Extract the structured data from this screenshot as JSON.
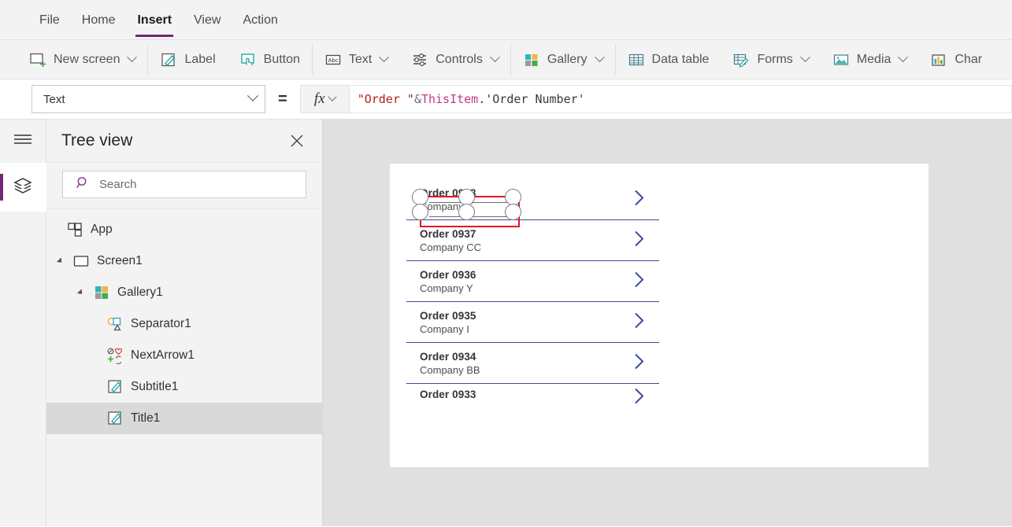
{
  "theme": {
    "accent": "#742774",
    "selection_red": "#e81123",
    "chevron_blue": "#3c4a9e"
  },
  "menubar": {
    "tabs": [
      {
        "label": "File",
        "active": false
      },
      {
        "label": "Home",
        "active": false
      },
      {
        "label": "Insert",
        "active": true
      },
      {
        "label": "View",
        "active": false
      },
      {
        "label": "Action",
        "active": false
      }
    ]
  },
  "ribbon": {
    "items": [
      {
        "label": "New screen",
        "icon": "new-screen-icon",
        "caret": true
      },
      {
        "label": "Label",
        "icon": "label-icon",
        "caret": false
      },
      {
        "label": "Button",
        "icon": "button-icon",
        "caret": false
      },
      {
        "label": "Text",
        "icon": "text-abc-icon",
        "caret": true
      },
      {
        "label": "Controls",
        "icon": "controls-icon",
        "caret": true
      },
      {
        "label": "Gallery",
        "icon": "gallery-icon",
        "caret": true
      },
      {
        "label": "Data table",
        "icon": "data-table-icon",
        "caret": false
      },
      {
        "label": "Forms",
        "icon": "forms-icon",
        "caret": true
      },
      {
        "label": "Media",
        "icon": "media-icon",
        "caret": true
      },
      {
        "label": "Char",
        "icon": "charts-icon",
        "caret": false
      }
    ]
  },
  "formulabar": {
    "property": "Text",
    "equals": "=",
    "fx_label": "fx",
    "formula_tokens": [
      {
        "text": "\"Order \"",
        "type": "string"
      },
      {
        "text": " & ",
        "type": "operator"
      },
      {
        "text": "ThisItem",
        "type": "identifier"
      },
      {
        "text": ".'Order Number'",
        "type": "plain"
      }
    ]
  },
  "treeview": {
    "title": "Tree view",
    "close_label": "✕",
    "search": {
      "placeholder": "Search",
      "value": ""
    },
    "nodes": [
      {
        "label": "App",
        "icon": "app-icon",
        "indent": 0,
        "twisty": "none",
        "selected": false
      },
      {
        "label": "Screen1",
        "icon": "screen-icon",
        "indent": 1,
        "twisty": "expanded",
        "selected": false
      },
      {
        "label": "Gallery1",
        "icon": "gallery-icon",
        "indent": 2,
        "twisty": "expanded",
        "selected": false
      },
      {
        "label": "Separator1",
        "icon": "shapes-icon",
        "indent": 3,
        "twisty": "none",
        "selected": false
      },
      {
        "label": "NextArrow1",
        "icon": "icons-icon",
        "indent": 3,
        "twisty": "none",
        "selected": false
      },
      {
        "label": "Subtitle1",
        "icon": "label-icon",
        "indent": 3,
        "twisty": "none",
        "selected": false
      },
      {
        "label": "Title1",
        "icon": "label-icon",
        "indent": 3,
        "twisty": "none",
        "selected": true
      }
    ]
  },
  "canvas": {
    "gallery": {
      "items": [
        {
          "title": "Order 0938",
          "subtitle": "Company F",
          "selected": true,
          "clipped": false
        },
        {
          "title": "Order 0937",
          "subtitle": "Company CC",
          "selected": false,
          "clipped": false
        },
        {
          "title": "Order 0936",
          "subtitle": "Company Y",
          "selected": false,
          "clipped": false
        },
        {
          "title": "Order 0935",
          "subtitle": "Company I",
          "selected": false,
          "clipped": false
        },
        {
          "title": "Order 0934",
          "subtitle": "Company BB",
          "selected": false,
          "clipped": false
        },
        {
          "title": "Order 0933",
          "subtitle": "",
          "selected": false,
          "clipped": true
        }
      ]
    }
  }
}
